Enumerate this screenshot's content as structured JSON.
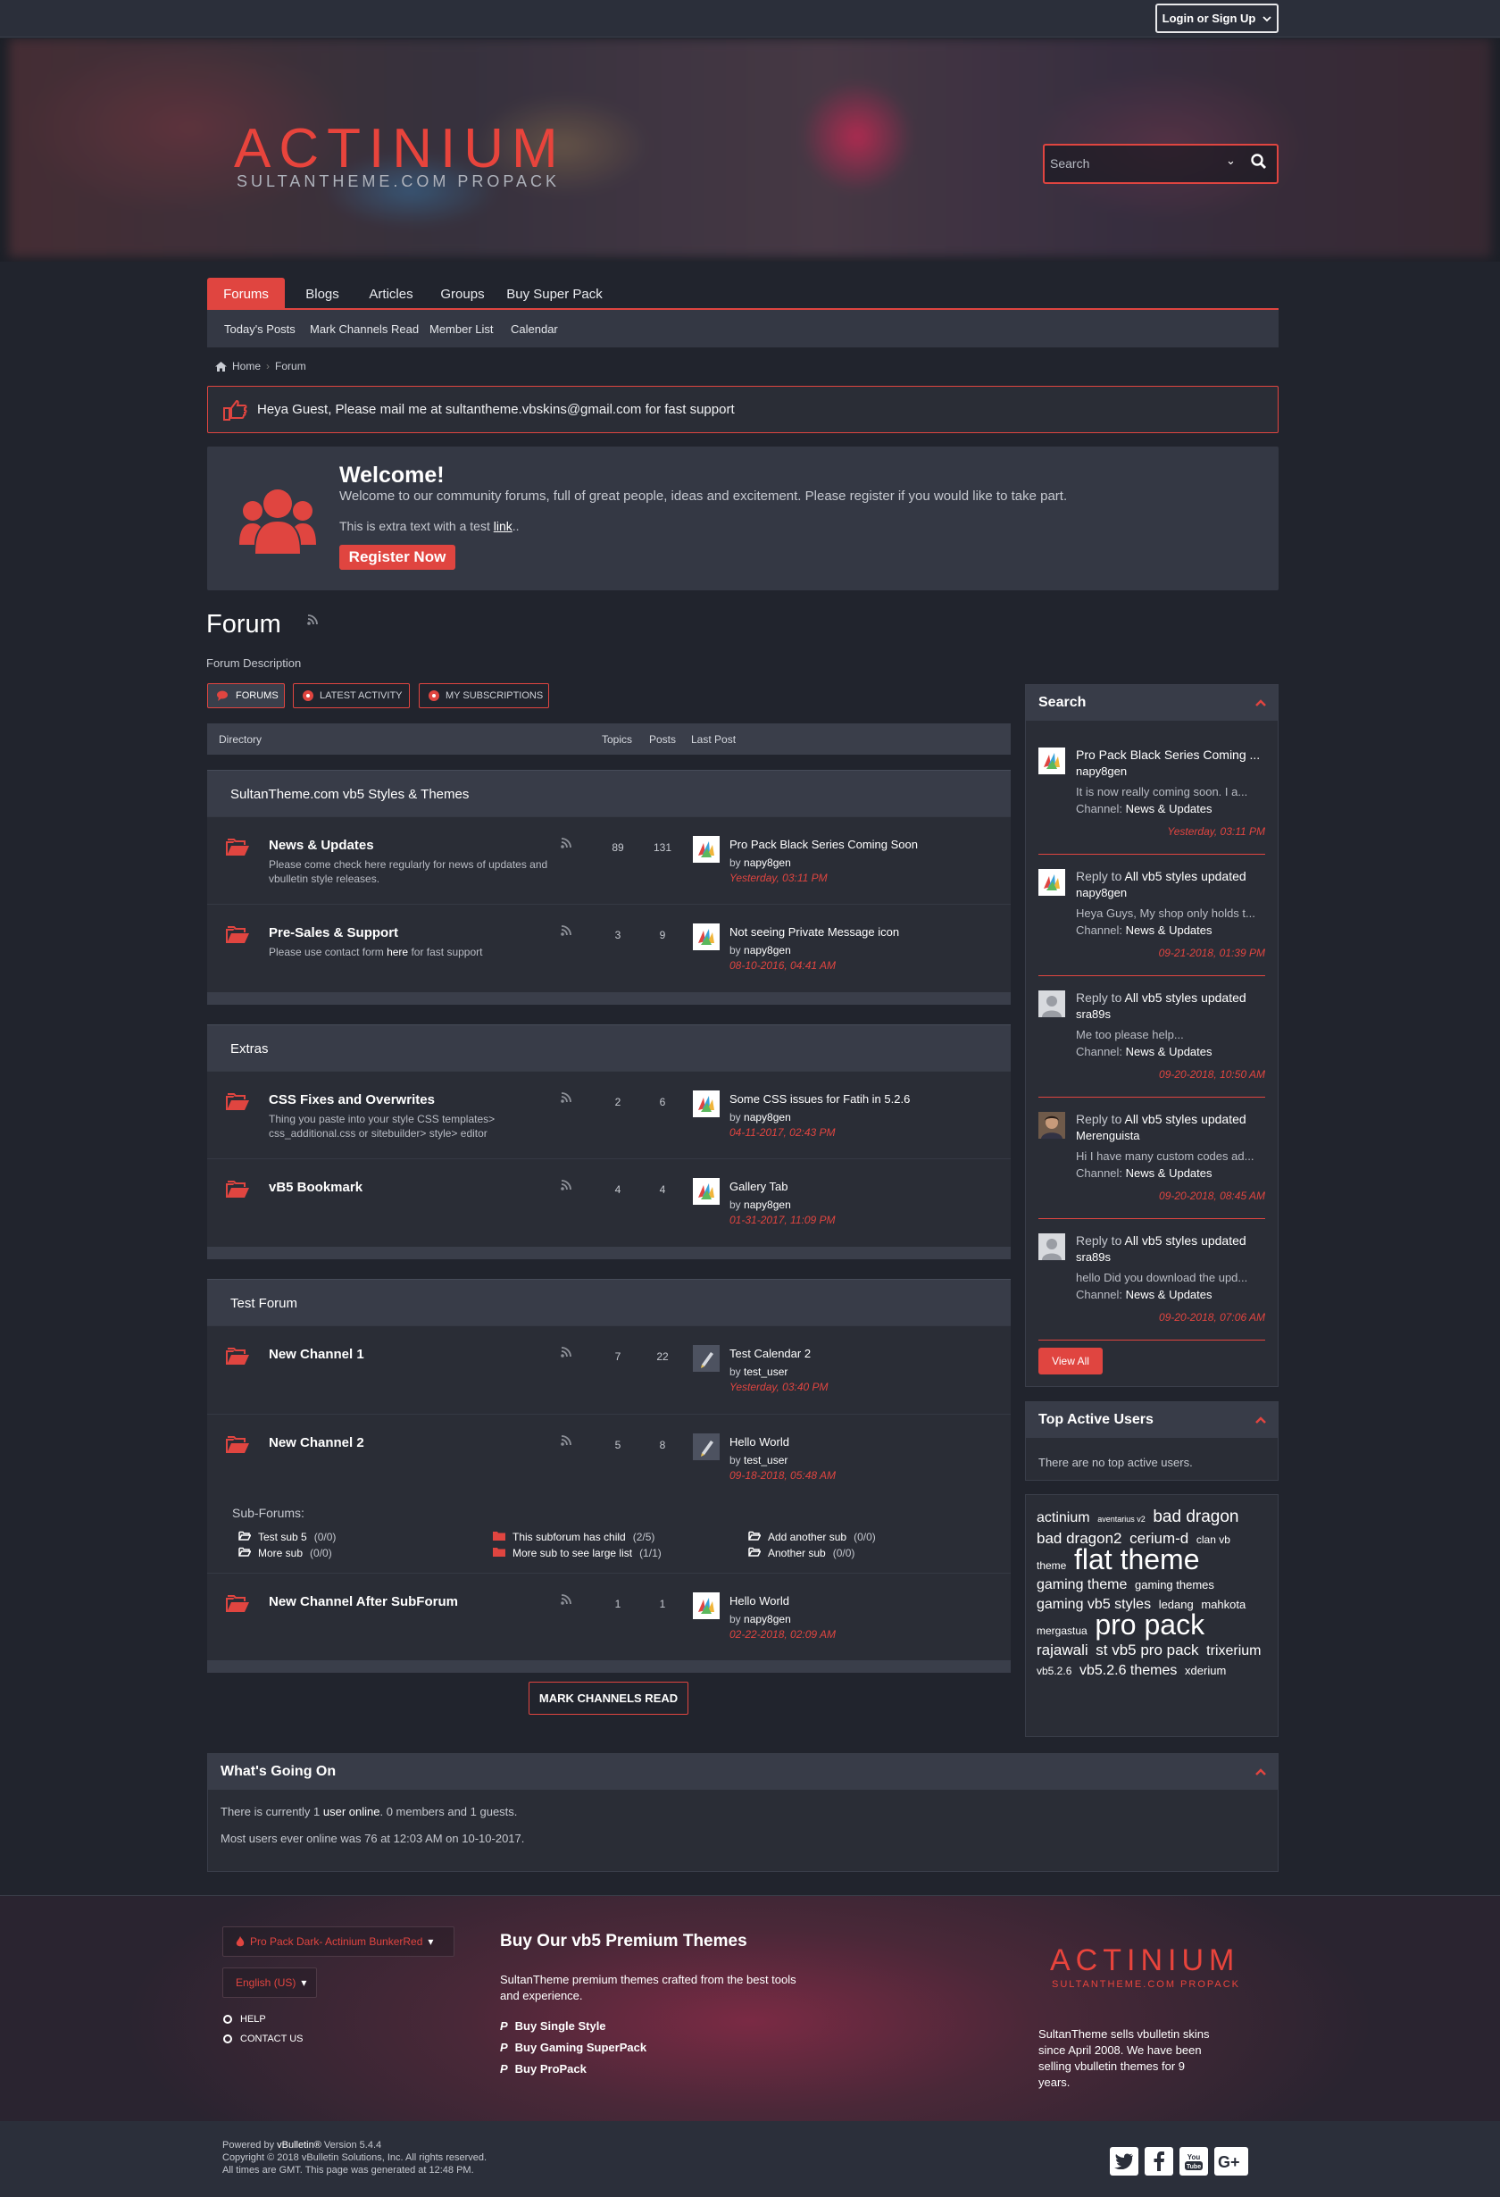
{
  "topbar": {
    "login_label": "Login or Sign Up"
  },
  "header": {
    "logo_title": "ACTINIUM",
    "logo_sub": "SULTANTHEME.COM PROPACK",
    "search_placeholder": "Search"
  },
  "nav": {
    "tabs": [
      "Forums",
      "Blogs",
      "Articles",
      "Groups",
      "Buy Super Pack"
    ],
    "active": "Forums",
    "subnav": [
      "Today's Posts",
      "Mark Channels Read",
      "Member List",
      "Calendar"
    ]
  },
  "breadcrumb": {
    "home": "Home",
    "current": "Forum"
  },
  "notice": "Heya Guest, Please mail me at sultantheme.vbskins@gmail.com for fast support",
  "welcome": {
    "title": "Welcome!",
    "desc": "Welcome to our community forums, full of great people, ideas and excitement. Please register if you would like to take part.",
    "extra_before": "This is extra text with a test ",
    "extra_link": "link",
    "extra_after": "..",
    "register": "Register Now"
  },
  "page": {
    "title": "Forum",
    "desc": "Forum Description"
  },
  "tabs": [
    "FORUMS",
    "LATEST ACTIVITY",
    "MY SUBSCRIPTIONS"
  ],
  "directory": {
    "col_dir": "Directory",
    "col_topics": "Topics",
    "col_posts": "Posts",
    "col_last": "Last Post"
  },
  "categories": [
    {
      "title": "SultanTheme.com vb5 Styles & Themes",
      "forums": [
        {
          "name": "News & Updates",
          "desc": "Please come check here regularly for news of updates and vbulletin style releases.",
          "topics": "89",
          "posts": "131",
          "last_title": "Pro Pack Black Series Coming Soon",
          "by": "by",
          "last_user": "napy8gen",
          "last_date": "Yesterday, 03:11 PM"
        },
        {
          "name": "Pre-Sales & Support",
          "desc_before": "Please use contact form ",
          "desc_link": "here",
          "desc_after": " for fast support",
          "topics": "3",
          "posts": "9",
          "last_title": "Not seeing Private Message icon",
          "by": "by",
          "last_user": "napy8gen",
          "last_date": "08-10-2016, 04:41 AM"
        }
      ]
    },
    {
      "title": "Extras",
      "forums": [
        {
          "name": "CSS Fixes and Overwrites",
          "desc": "Thing you paste into your style CSS templates> css_additional.css or sitebuilder> style> editor",
          "topics": "2",
          "posts": "6",
          "last_title": "Some CSS issues for Fatih in 5.2.6",
          "by": "by",
          "last_user": "napy8gen",
          "last_date": "04-11-2017, 02:43 PM"
        },
        {
          "name": "vB5 Bookmark",
          "desc": "",
          "topics": "4",
          "posts": "4",
          "last_title": "Gallery Tab",
          "by": "by",
          "last_user": "napy8gen",
          "last_date": "01-31-2017, 11:09 PM"
        }
      ]
    },
    {
      "title": "Test Forum",
      "forums": [
        {
          "name": "New Channel 1",
          "topics": "7",
          "posts": "22",
          "last_title": "Test Calendar 2",
          "by": "by",
          "last_user": "test_user",
          "last_date": "Yesterday, 03:40 PM"
        },
        {
          "name": "New Channel 2",
          "topics": "5",
          "posts": "8",
          "last_title": "Hello World",
          "by": "by",
          "last_user": "test_user",
          "last_date": "09-18-2018, 05:48 AM"
        },
        {
          "name": "New Channel After SubForum",
          "topics": "1",
          "posts": "1",
          "last_title": "Hello World",
          "by": "by",
          "last_user": "napy8gen",
          "last_date": "02-22-2018, 02:09 AM"
        }
      ],
      "subforums_label": "Sub-Forums:",
      "subforums": [
        {
          "name": "Test sub 5",
          "count": "(0/0)"
        },
        {
          "name": "More sub",
          "count": "(0/0)"
        },
        {
          "name": "This subforum has child",
          "count": "(2/5)"
        },
        {
          "name": "More sub to see large list",
          "count": "(1/1)"
        },
        {
          "name": "Add another sub",
          "count": "(0/0)"
        },
        {
          "name": "Another sub",
          "count": "(0/0)"
        }
      ]
    }
  ],
  "mark_read": "MARK CHANNELS READ",
  "search_widget": {
    "title": "Search",
    "reply_to": "Reply to",
    "channel_label": "Channel:",
    "items": [
      {
        "title": "Pro Pack Black Series Coming ...",
        "user": "napy8gen",
        "snippet": "It is now really coming soon. I a...",
        "channel": "News & Updates",
        "date": "Yesterday, 03:11 PM",
        "reply": false
      },
      {
        "title": "All vb5 styles updated",
        "user": "napy8gen",
        "snippet": "Heya Guys, My shop only holds t...",
        "channel": "News & Updates",
        "date": "09-21-2018, 01:39 PM",
        "reply": true
      },
      {
        "title": "All vb5 styles updated",
        "user": "sra89s",
        "snippet": "Me too please help...",
        "channel": "News & Updates",
        "date": "09-20-2018, 10:50 AM",
        "reply": true
      },
      {
        "title": "All vb5 styles updated",
        "user": "Merenguista",
        "snippet": "Hi I have many custom codes ad...",
        "channel": "News & Updates",
        "date": "09-20-2018, 08:45 AM",
        "reply": true
      },
      {
        "title": "All vb5 styles updated",
        "user": "sra89s",
        "snippet": "hello Did you download the upd...",
        "channel": "News & Updates",
        "date": "09-20-2018, 07:06 AM",
        "reply": true
      }
    ],
    "view_all": "View All"
  },
  "top_users": {
    "title": "Top Active Users",
    "empty": "There are no top active users."
  },
  "tags": [
    {
      "t": "actinium",
      "s": 16
    },
    {
      "t": "aventarius v2",
      "s": 9
    },
    {
      "t": "bad dragon",
      "s": 19
    },
    {
      "t": "bad dragon2",
      "s": 17
    },
    {
      "t": "cerium-d",
      "s": 17
    },
    {
      "t": "clan vb",
      "s": 12
    },
    {
      "t": "theme",
      "s": 12
    },
    {
      "t": "flat theme",
      "s": 32
    },
    {
      "t": "gaming theme",
      "s": 16
    },
    {
      "t": "gaming themes",
      "s": 13
    },
    {
      "t": "gaming vb5 styles",
      "s": 16
    },
    {
      "t": "ledang",
      "s": 13
    },
    {
      "t": "mahkota",
      "s": 13
    },
    {
      "t": "mergastua",
      "s": 12
    },
    {
      "t": "pro pack",
      "s": 32
    },
    {
      "t": "rajawali",
      "s": 17
    },
    {
      "t": "st vb5 pro pack",
      "s": 17
    },
    {
      "t": "trixerium",
      "s": 16
    },
    {
      "t": "vb5.2.6",
      "s": 12
    },
    {
      "t": "vb5.2.6 themes",
      "s": 16
    },
    {
      "t": "xderium",
      "s": 13
    }
  ],
  "wgo": {
    "title": "What's Going On",
    "line1_before": "There is currently 1 ",
    "line1_link": "user online",
    "line1_after": ". 0 members and 1 guests.",
    "line2": "Most users ever online was 76 at 12:03 AM on 10-10-2017."
  },
  "footer": {
    "style_select": "Pro Pack Dark- Actinium BunkerRed",
    "lang_select": "English (US)",
    "help": "HELP",
    "contact": "CONTACT US",
    "heading": "Buy Our vb5 Premium Themes",
    "para": "SultanTheme premium themes crafted from the best tools and experience.",
    "buy": [
      "Buy Single Style",
      "Buy Gaming SuperPack",
      "Buy ProPack"
    ],
    "logo_title": "ACTINIUM",
    "logo_sub": "SULTANTHEME.COM PROPACK",
    "about": "SultanTheme sells vbulletin skins since April 2008. We have been selling vbulletin themes for 9 years."
  },
  "bottom": {
    "powered_before": "Powered by ",
    "powered_brand": "vBulletin®",
    "powered_after": " Version 5.4.4",
    "copyright": "Copyright © 2018 vBulletin Solutions, Inc. All rights reserved.",
    "times": "All times are GMT. This page was generated at 12:48 PM."
  },
  "colors": {
    "accent": "#e04540",
    "bg": "#21242d",
    "panel": "#2a2d36",
    "panel_head": "#383c48"
  },
  "icons": [
    "caret-down-icon",
    "search-icon",
    "home-icon",
    "thumbs-icon",
    "users-icon",
    "rss-icon",
    "folder-open-icon",
    "folder-icon",
    "dot-circle-icon",
    "chevron-up-icon",
    "paypal-icon",
    "twitter-icon",
    "facebook-icon",
    "youtube-icon",
    "google-plus-icon"
  ]
}
